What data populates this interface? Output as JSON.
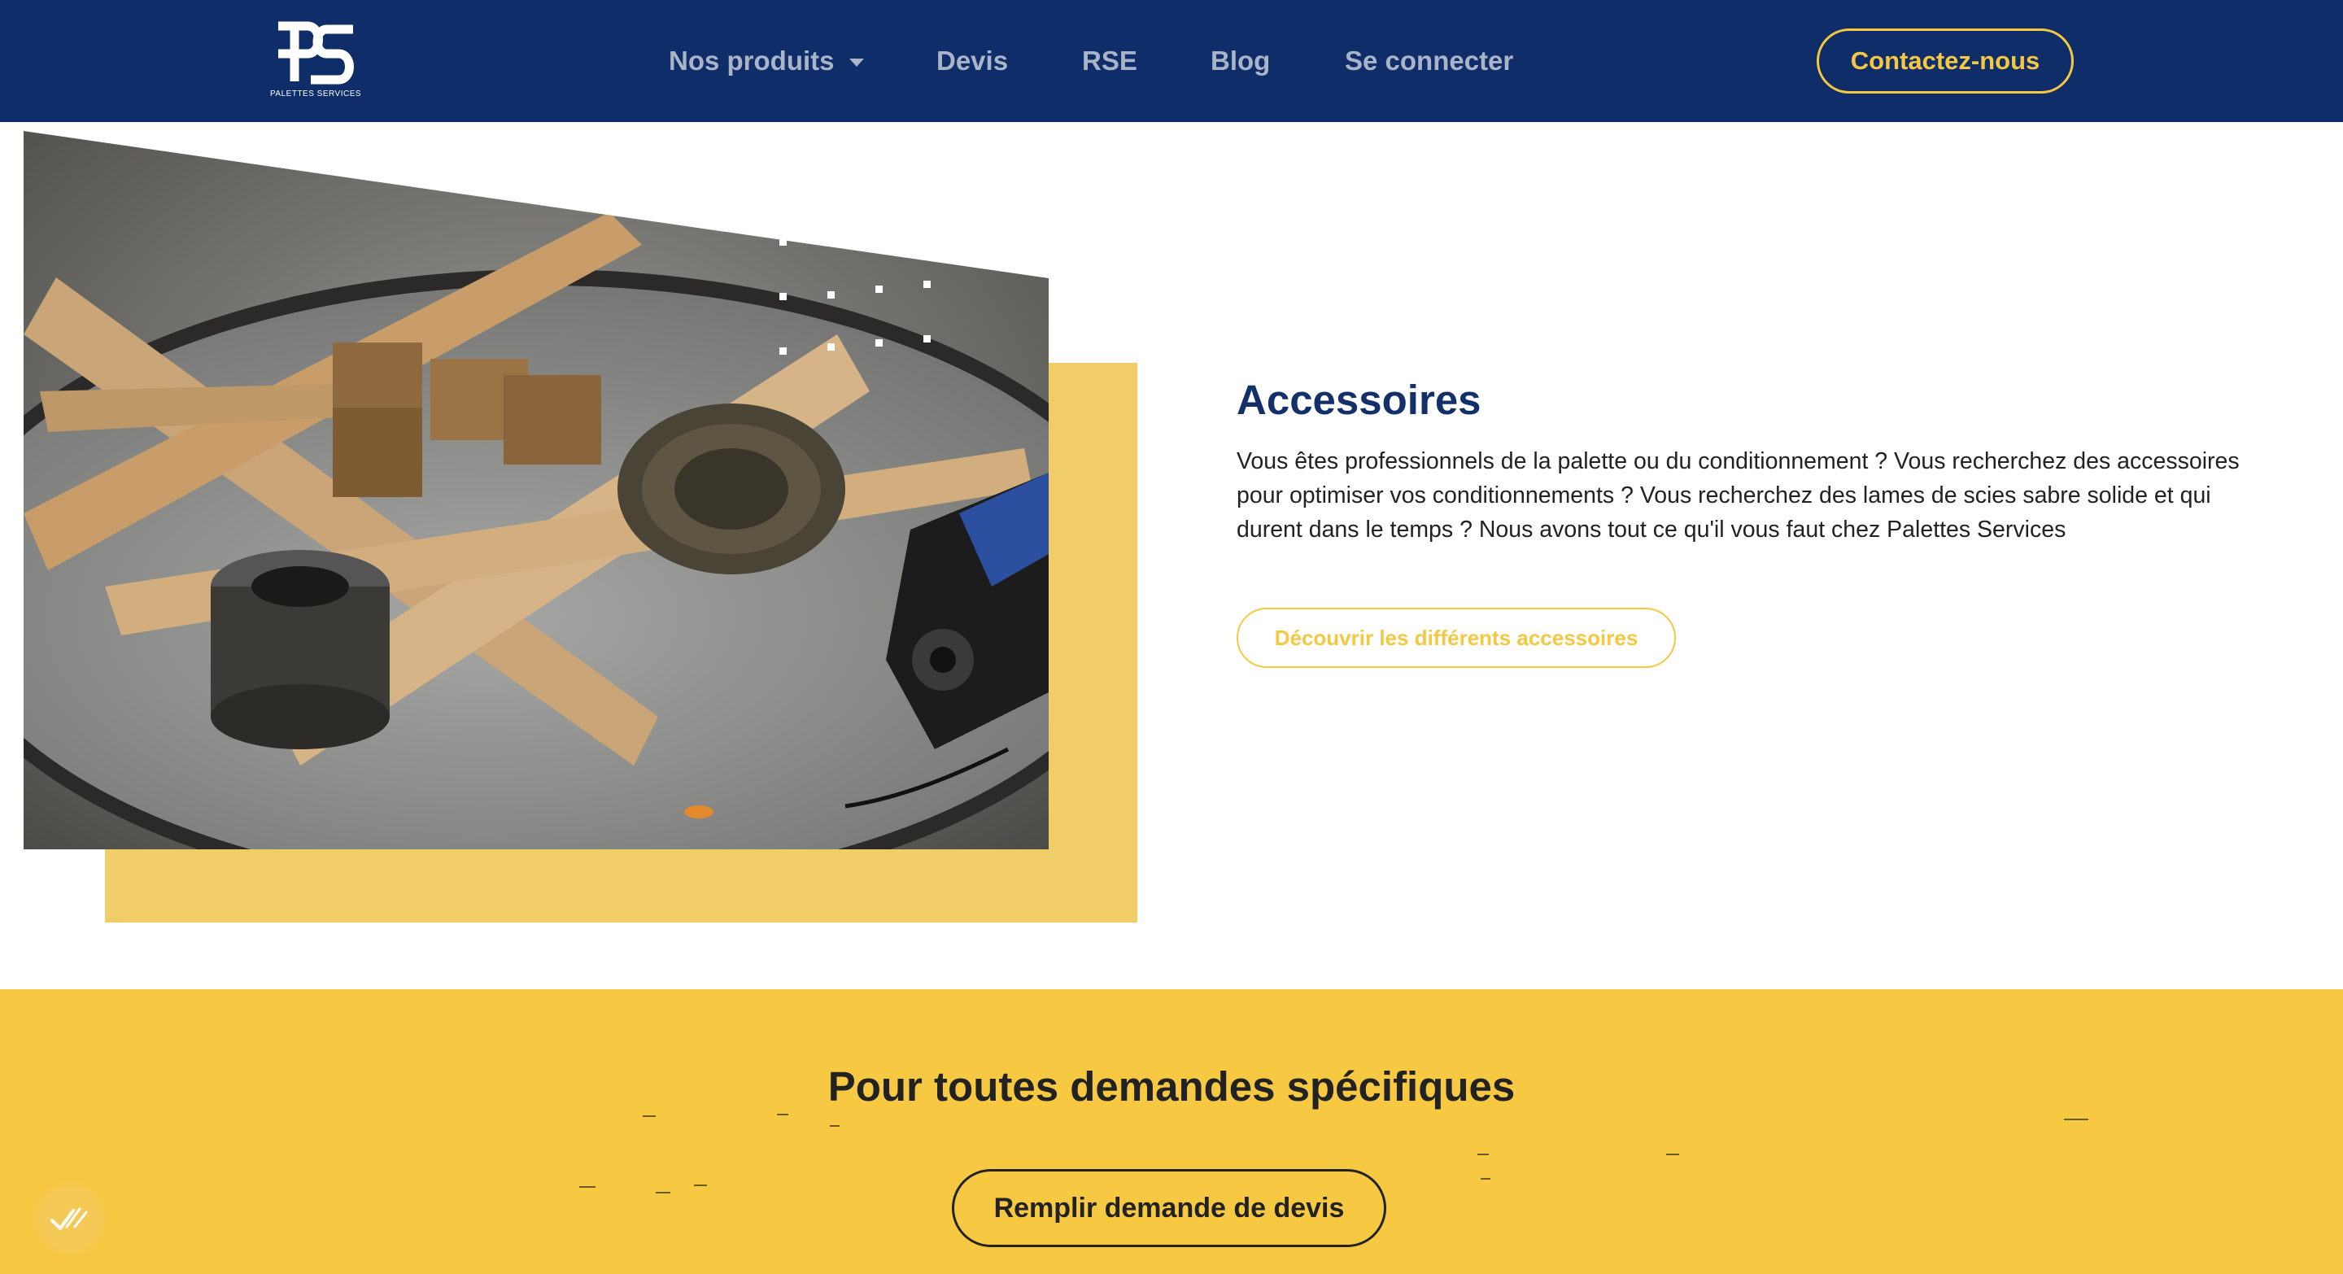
{
  "header": {
    "logo_text": "PALETTES SERVICES",
    "nav": {
      "products": "Nos produits",
      "quote": "Devis",
      "csr": "RSE",
      "blog": "Blog",
      "login": "Se connecter"
    },
    "contact_button": "Contactez-nous"
  },
  "accessories": {
    "title": "Accessoires",
    "description": "Vous êtes professionnels de la palette ou du conditionnement ? Vous recherchez des accessoires pour optimiser vos conditionnements ? Vous recherchez des lames de scies sabre solide et qui durent dans le temps ?  Nous avons tout ce qu'il vous faut chez Palettes Services",
    "button": "Découvrir les différents accessoires"
  },
  "cta": {
    "title": "Pour toutes demandes spécifiques",
    "button": "Remplir demande de devis"
  },
  "colors": {
    "header_bg": "#0f2d69",
    "accent_yellow": "#f5c842",
    "band_yellow": "#f7c942",
    "title_blue": "#13306b"
  }
}
